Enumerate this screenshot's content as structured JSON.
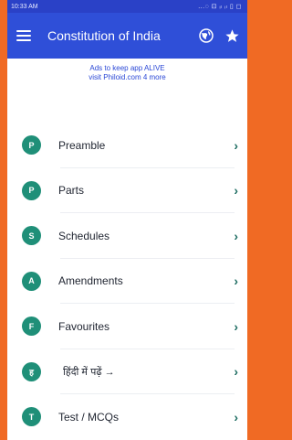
{
  "status_bar": {
    "time": "10:33 AM",
    "indicators": "...◌ ⊡ ᵢₗ ᵢₗ ▯ ◻"
  },
  "app_bar": {
    "title": "Constitution of India",
    "icons": [
      "menu-icon",
      "globe-icon",
      "star-icon"
    ]
  },
  "ad_banner": {
    "line1": "Ads to keep app ALIVE",
    "line2": "visit Philoid.com 4 more"
  },
  "colors": {
    "primary": "#2f4fd8",
    "status": "#2a41c7",
    "accent": "#1f8f78",
    "background": "#f06a24"
  },
  "menu": {
    "items": [
      {
        "letter": "P",
        "label": "Preamble"
      },
      {
        "letter": "P",
        "label": "Parts"
      },
      {
        "letter": "S",
        "label": "Schedules"
      },
      {
        "letter": "A",
        "label": "Amendments"
      },
      {
        "letter": "F",
        "label": "Favourites"
      },
      {
        "letter": "ह",
        "label": "हिंदी में पढ़ें →"
      },
      {
        "letter": "T",
        "label": "Test / MCQs"
      }
    ],
    "chevron": "›"
  }
}
